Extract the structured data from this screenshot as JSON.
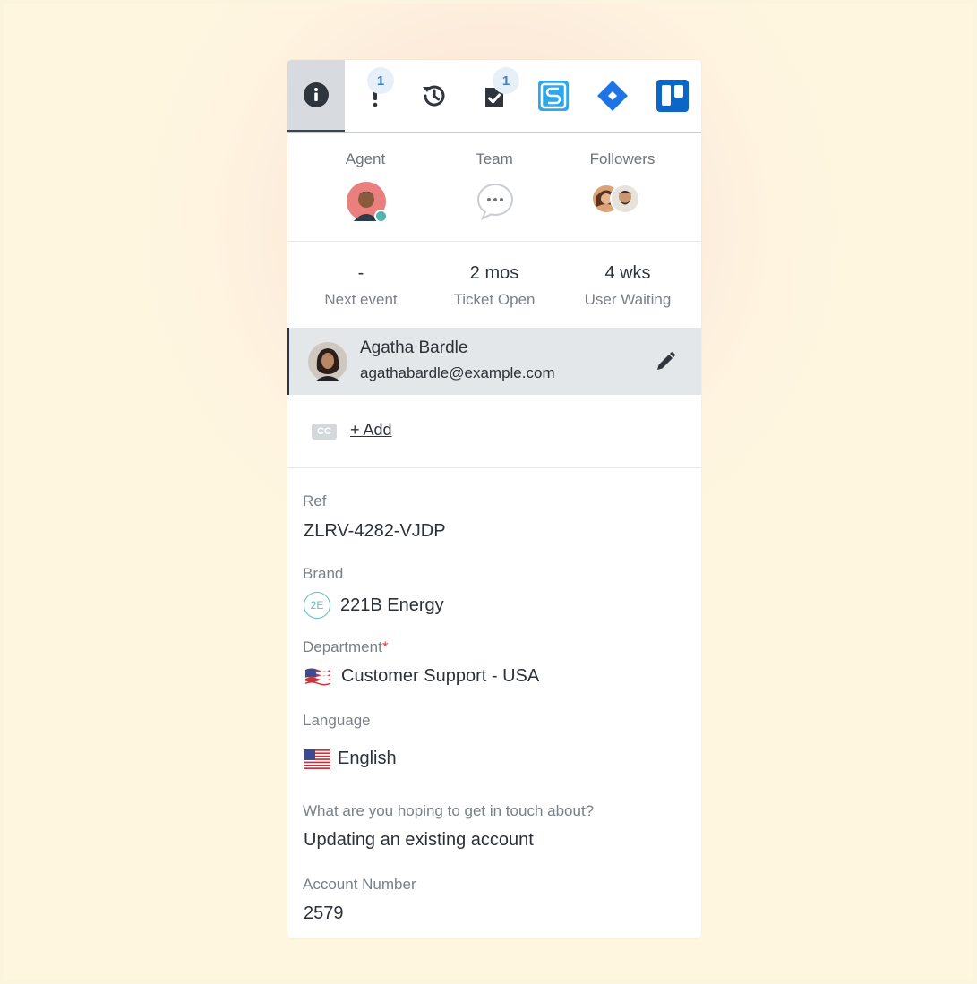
{
  "toolbar": {
    "items": [
      {
        "icon": "info-icon",
        "active": true
      },
      {
        "icon": "alert-icon",
        "badge": "1"
      },
      {
        "icon": "history-icon"
      },
      {
        "icon": "task-icon",
        "badge": "1"
      },
      {
        "icon": "app-s-icon"
      },
      {
        "icon": "jira-icon"
      },
      {
        "icon": "trello-icon"
      }
    ]
  },
  "people": {
    "agent_label": "Agent",
    "team_label": "Team",
    "followers_label": "Followers"
  },
  "stats": [
    {
      "value": "-",
      "label": "Next event"
    },
    {
      "value": "2 mos",
      "label": "Ticket Open"
    },
    {
      "value": "4 wks",
      "label": "User Waiting"
    }
  ],
  "requester": {
    "name": "Agatha Bardle",
    "email": "agathabardle@example.com"
  },
  "cc": {
    "tag": "CC",
    "add_label": "+ Add"
  },
  "fields": {
    "ref_label": "Ref",
    "ref_value": "ZLRV-4282-VJDP",
    "brand_label": "Brand",
    "brand_badge": "2E",
    "brand_value": "221B Energy",
    "department_label": "Department",
    "department_required": "*",
    "department_value": "Customer Support - USA",
    "language_label": "Language",
    "language_value": "English",
    "topic_label": "What are you hoping to get in touch about?",
    "topic_value": "Updating an existing account",
    "account_label": "Account Number",
    "account_value": "2579"
  },
  "colors": {
    "accent_blue": "#3d80c9",
    "required_red": "#d83a3a",
    "online_status": "#4fb5ae",
    "brand_teal": "#5fbfb6"
  }
}
